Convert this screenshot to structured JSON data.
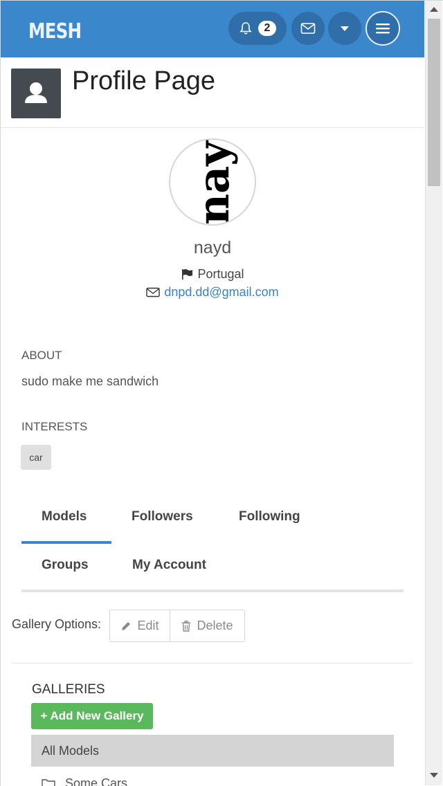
{
  "navbar": {
    "brand": "MESH",
    "notifications_count": "2",
    "icons": [
      "bell-icon",
      "envelope-icon",
      "caret-down-icon",
      "hamburger-menu-icon"
    ],
    "color": "#3b87cb"
  },
  "page": {
    "title": "Profile Page"
  },
  "profile": {
    "picture_text": "nay",
    "username": "nayd",
    "country": "Portugal",
    "email": "dnpd.dd@gmail.com"
  },
  "about": {
    "label": "ABOUT",
    "text": "sudo make me sandwich"
  },
  "interests": {
    "label": "INTERESTS",
    "tags": [
      "car"
    ]
  },
  "tabs": [
    {
      "label": "Models",
      "active": true
    },
    {
      "label": "Followers",
      "active": false
    },
    {
      "label": "Following",
      "active": false
    },
    {
      "label": "Groups",
      "active": false
    },
    {
      "label": "My Account",
      "active": false
    }
  ],
  "gallery_options": {
    "label": "Gallery Options:",
    "edit_label": "Edit",
    "delete_label": "Delete"
  },
  "galleries": {
    "label": "GALLERIES",
    "add_button": "+ Add New Gallery",
    "items": [
      "All Models",
      "Some Cars"
    ]
  },
  "colors": {
    "accent": "#3b87cb",
    "success": "#5cb85c",
    "link": "#3b82c4"
  }
}
